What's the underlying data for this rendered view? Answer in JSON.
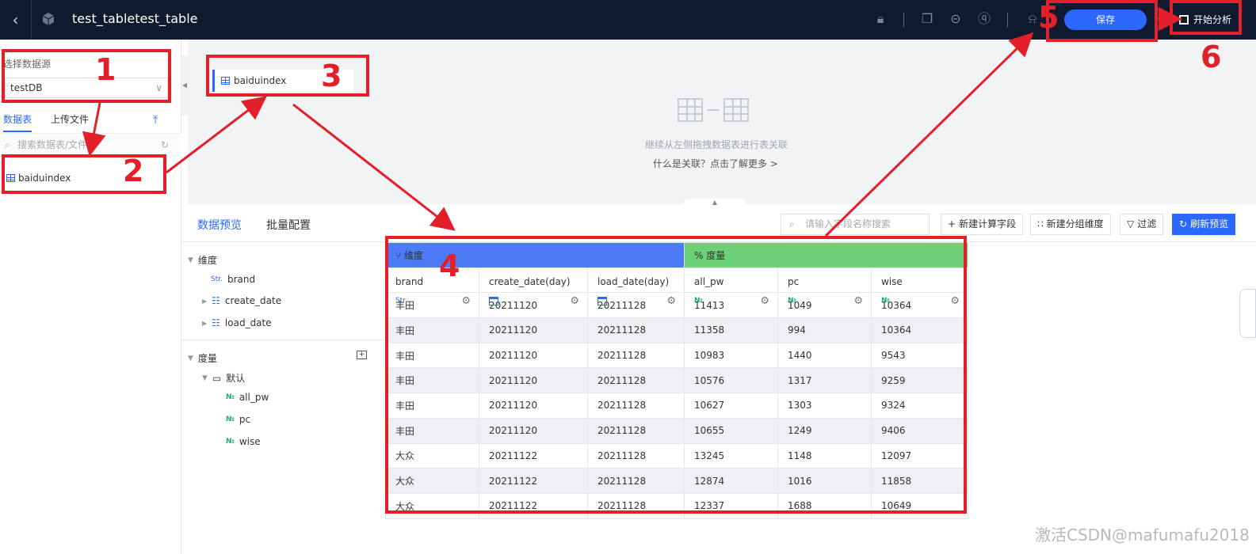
{
  "topbar": {
    "title": "test_tabletest_table",
    "save_label": "保存",
    "start_label": "开始分析"
  },
  "left_panel": {
    "datasource_label": "选择数据源",
    "datasource_value": "testDB",
    "tabs": [
      "数据表",
      "上传文件"
    ],
    "search_placeholder": "搜索数据表/文件",
    "table_item": "baiduindex"
  },
  "canvas": {
    "table_card": "baiduindex",
    "hint": "继续从左侧拖拽数据表进行表关联",
    "help_link": "什么是关联？点击了解更多 >"
  },
  "bottom": {
    "tabs": [
      "数据预览",
      "批量配置"
    ],
    "field_search_placeholder": "请输入字段名称搜索",
    "buttons": [
      "新建计算字段",
      "新建分组维度",
      "过滤",
      "刷新预览"
    ]
  },
  "field_tree": {
    "dimension_group": "维度",
    "dimensions": [
      "brand",
      "create_date",
      "load_date"
    ],
    "measure_group": "度量",
    "folder": "默认",
    "measures": [
      "all_pw",
      "pc",
      "wise"
    ],
    "type_str": "Str.",
    "type_num": "№"
  },
  "grid": {
    "dimension_header": "维度",
    "measure_header": "度量",
    "columns": [
      "brand",
      "create_date(day)",
      "load_date(day)",
      "all_pw",
      "pc",
      "wise"
    ],
    "rows": [
      [
        "丰田",
        "20211120",
        "20211128",
        "11413",
        "1049",
        "10364"
      ],
      [
        "丰田",
        "20211120",
        "20211128",
        "11358",
        "994",
        "10364"
      ],
      [
        "丰田",
        "20211120",
        "20211128",
        "10983",
        "1440",
        "9543"
      ],
      [
        "丰田",
        "20211120",
        "20211128",
        "10576",
        "1317",
        "9259"
      ],
      [
        "丰田",
        "20211120",
        "20211128",
        "10627",
        "1303",
        "9324"
      ],
      [
        "丰田",
        "20211120",
        "20211128",
        "10655",
        "1249",
        "9406"
      ],
      [
        "大众",
        "20211122",
        "20211128",
        "13245",
        "1148",
        "12097"
      ],
      [
        "大众",
        "20211122",
        "20211128",
        "12874",
        "1016",
        "11858"
      ],
      [
        "大众",
        "20211122",
        "20211128",
        "12337",
        "1688",
        "10649"
      ]
    ]
  },
  "annotations": [
    "1",
    "2",
    "3",
    "4",
    "5",
    "6"
  ],
  "watermark": "激活CSDN@mafumafu2018",
  "colors": {
    "accent": "#2c68ff",
    "dimension": "#4c7bf5",
    "measure": "#6bd076",
    "annotation": "#e3202a"
  }
}
